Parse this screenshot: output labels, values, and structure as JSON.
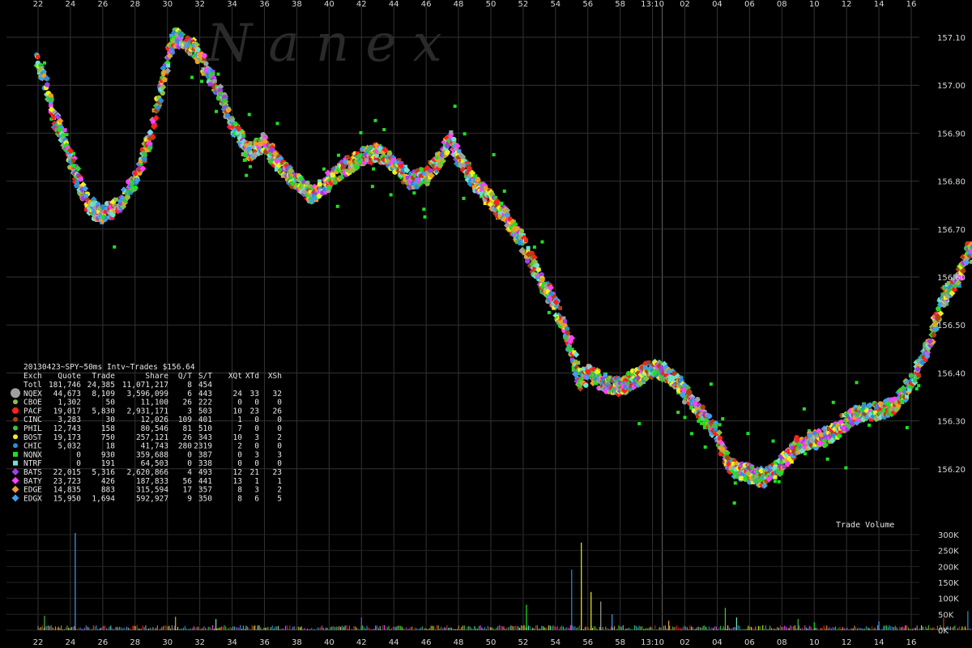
{
  "chart_data": {
    "type": "scatter",
    "title": "20130423~SPY~50ms Intv~Trades $156.64",
    "watermark": "N a n e x",
    "time_labels": [
      "22",
      "24",
      "26",
      "28",
      "30",
      "32",
      "34",
      "36",
      "38",
      "40",
      "42",
      "44",
      "46",
      "48",
      "50",
      "52",
      "54",
      "56",
      "58",
      "13:10",
      "02",
      "04",
      "06",
      "08",
      "10",
      "12",
      "14",
      "16"
    ],
    "price_ticks": [
      157.1,
      157.0,
      156.9,
      156.8,
      156.7,
      156.6,
      156.5,
      156.4,
      156.3,
      156.2
    ],
    "price_tick_labels": [
      "157.10",
      "157.00",
      "156.90",
      "156.80",
      "156.70",
      "156.60",
      "156.50",
      "156.40",
      "156.30",
      "156.20"
    ],
    "ylim": [
      156.17,
      157.12
    ],
    "volume_title": "Trade Volume",
    "volume_ticks": [
      "300K",
      "250K",
      "200K",
      "150K",
      "100K",
      "50K",
      "0K"
    ],
    "volume_ylim": [
      0,
      300000
    ],
    "price_path": [
      {
        "x": 0.0,
        "y": 157.05
      },
      {
        "x": 0.5,
        "y": 157.0
      },
      {
        "x": 1.0,
        "y": 156.93
      },
      {
        "x": 1.5,
        "y": 156.9
      },
      {
        "x": 2.0,
        "y": 156.85
      },
      {
        "x": 2.5,
        "y": 156.8
      },
      {
        "x": 3.0,
        "y": 156.76
      },
      {
        "x": 3.5,
        "y": 156.74
      },
      {
        "x": 4.0,
        "y": 156.73
      },
      {
        "x": 5.0,
        "y": 156.75
      },
      {
        "x": 6.0,
        "y": 156.8
      },
      {
        "x": 7.0,
        "y": 156.9
      },
      {
        "x": 7.5,
        "y": 156.98
      },
      {
        "x": 8.0,
        "y": 157.06
      },
      {
        "x": 8.5,
        "y": 157.1
      },
      {
        "x": 9.5,
        "y": 157.08
      },
      {
        "x": 10.0,
        "y": 157.06
      },
      {
        "x": 11.0,
        "y": 157.0
      },
      {
        "x": 12.0,
        "y": 156.92
      },
      {
        "x": 13.0,
        "y": 156.86
      },
      {
        "x": 14.0,
        "y": 156.88
      },
      {
        "x": 15.0,
        "y": 156.83
      },
      {
        "x": 16.0,
        "y": 156.8
      },
      {
        "x": 17.0,
        "y": 156.77
      },
      {
        "x": 18.0,
        "y": 156.8
      },
      {
        "x": 19.0,
        "y": 156.83
      },
      {
        "x": 20.0,
        "y": 156.85
      },
      {
        "x": 21.0,
        "y": 156.86
      },
      {
        "x": 22.0,
        "y": 156.84
      },
      {
        "x": 23.0,
        "y": 156.8
      },
      {
        "x": 24.0,
        "y": 156.81
      },
      {
        "x": 25.0,
        "y": 156.85
      },
      {
        "x": 25.5,
        "y": 156.89
      },
      {
        "x": 26.0,
        "y": 156.85
      },
      {
        "x": 27.0,
        "y": 156.8
      },
      {
        "x": 28.0,
        "y": 156.76
      },
      {
        "x": 29.0,
        "y": 156.72
      },
      {
        "x": 30.0,
        "y": 156.67
      },
      {
        "x": 31.0,
        "y": 156.6
      },
      {
        "x": 32.0,
        "y": 156.54
      },
      {
        "x": 33.0,
        "y": 156.45
      },
      {
        "x": 33.5,
        "y": 156.38
      },
      {
        "x": 34.0,
        "y": 156.4
      },
      {
        "x": 35.0,
        "y": 156.38
      },
      {
        "x": 36.0,
        "y": 156.37
      },
      {
        "x": 37.0,
        "y": 156.39
      },
      {
        "x": 38.0,
        "y": 156.41
      },
      {
        "x": 39.0,
        "y": 156.4
      },
      {
        "x": 40.0,
        "y": 156.36
      },
      {
        "x": 41.0,
        "y": 156.32
      },
      {
        "x": 42.0,
        "y": 156.27
      },
      {
        "x": 42.5,
        "y": 156.22
      },
      {
        "x": 43.0,
        "y": 156.2
      },
      {
        "x": 44.0,
        "y": 156.19
      },
      {
        "x": 45.0,
        "y": 156.18
      },
      {
        "x": 46.0,
        "y": 156.21
      },
      {
        "x": 47.0,
        "y": 156.25
      },
      {
        "x": 48.0,
        "y": 156.26
      },
      {
        "x": 49.0,
        "y": 156.27
      },
      {
        "x": 50.0,
        "y": 156.3
      },
      {
        "x": 51.0,
        "y": 156.32
      },
      {
        "x": 52.0,
        "y": 156.32
      },
      {
        "x": 53.0,
        "y": 156.33
      },
      {
        "x": 54.0,
        "y": 156.38
      },
      {
        "x": 55.0,
        "y": 156.45
      },
      {
        "x": 56.0,
        "y": 156.56
      },
      {
        "x": 57.0,
        "y": 156.6
      },
      {
        "x": 57.5,
        "y": 156.66
      },
      {
        "x": 58.0,
        "y": 156.63
      }
    ],
    "volume_spikes": [
      {
        "x": 2.3,
        "v": 305000
      },
      {
        "x": 0.4,
        "v": 45000
      },
      {
        "x": 8.5,
        "v": 42000
      },
      {
        "x": 11.0,
        "v": 35000
      },
      {
        "x": 20.0,
        "v": 40000
      },
      {
        "x": 30.2,
        "v": 80000
      },
      {
        "x": 33.0,
        "v": 190000
      },
      {
        "x": 33.6,
        "v": 275000
      },
      {
        "x": 34.2,
        "v": 120000
      },
      {
        "x": 34.8,
        "v": 90000
      },
      {
        "x": 35.5,
        "v": 50000
      },
      {
        "x": 39.0,
        "v": 30000
      },
      {
        "x": 42.5,
        "v": 70000
      },
      {
        "x": 43.2,
        "v": 40000
      },
      {
        "x": 47.0,
        "v": 35000
      },
      {
        "x": 48.0,
        "v": 25000
      },
      {
        "x": 52.0,
        "v": 28000
      },
      {
        "x": 56.0,
        "v": 38000
      },
      {
        "x": 57.5,
        "v": 60000
      }
    ],
    "legend": {
      "header": [
        "Exch",
        "Quote",
        "Trade",
        "Share",
        "Q/T",
        "S/T",
        "XQt",
        "XTd",
        "XSh"
      ],
      "rows": [
        {
          "exch": "Totl",
          "quote": "181,746",
          "trade": "24,385",
          "share": "11,071,217",
          "qt": "8",
          "st": "454",
          "xqt": "",
          "xtd": "",
          "xsh": "",
          "color": "",
          "marker": ""
        },
        {
          "exch": "NQEX",
          "quote": "44,673",
          "trade": "8,109",
          "share": "3,596,099",
          "qt": "6",
          "st": "443",
          "xqt": "24",
          "xtd": "33",
          "xsh": "32",
          "color": "#a0a0a0",
          "marker": "circle-large"
        },
        {
          "exch": "CBOE",
          "quote": "1,302",
          "trade": "50",
          "share": "11,100",
          "qt": "26",
          "st": "222",
          "xqt": "0",
          "xtd": "0",
          "xsh": "0",
          "color": "#8fbf3f",
          "marker": "circle"
        },
        {
          "exch": "PACF",
          "quote": "19,017",
          "trade": "5,830",
          "share": "2,931,171",
          "qt": "3",
          "st": "503",
          "xqt": "10",
          "xtd": "23",
          "xsh": "26",
          "color": "#ff2020",
          "marker": "circle-medium"
        },
        {
          "exch": "CINC",
          "quote": "3,283",
          "trade": "30",
          "share": "12,026",
          "qt": "109",
          "st": "401",
          "xqt": "1",
          "xtd": "0",
          "xsh": "0",
          "color": "#b04010",
          "marker": "circle"
        },
        {
          "exch": "PHIL",
          "quote": "12,743",
          "trade": "158",
          "share": "80,546",
          "qt": "81",
          "st": "510",
          "xqt": "7",
          "xtd": "0",
          "xsh": "0",
          "color": "#40c040",
          "marker": "circle"
        },
        {
          "exch": "BOST",
          "quote": "19,173",
          "trade": "750",
          "share": "257,121",
          "qt": "26",
          "st": "343",
          "xqt": "10",
          "xtd": "3",
          "xsh": "2",
          "color": "#f0f020",
          "marker": "circle"
        },
        {
          "exch": "CHIC",
          "quote": "5,032",
          "trade": "18",
          "share": "41,743",
          "qt": "280",
          "st": "2319",
          "xqt": "2",
          "xtd": "0",
          "xsh": "0",
          "color": "#2a8fd8",
          "marker": "circle"
        },
        {
          "exch": "NQNX",
          "quote": "0",
          "trade": "930",
          "share": "359,688",
          "qt": "0",
          "st": "387",
          "xqt": "0",
          "xtd": "3",
          "xsh": "3",
          "color": "#20e020",
          "marker": "square"
        },
        {
          "exch": "NTRF",
          "quote": "0",
          "trade": "191",
          "share": "64,503",
          "qt": "0",
          "st": "338",
          "xqt": "0",
          "xtd": "0",
          "xsh": "0",
          "color": "#70e0d0",
          "marker": "square"
        },
        {
          "exch": "BATS",
          "quote": "22,015",
          "trade": "5,316",
          "share": "2,620,866",
          "qt": "4",
          "st": "493",
          "xqt": "12",
          "xtd": "21",
          "xsh": "23",
          "color": "#a040e0",
          "marker": "diamond"
        },
        {
          "exch": "BATY",
          "quote": "23,723",
          "trade": "426",
          "share": "187,833",
          "qt": "56",
          "st": "441",
          "xqt": "13",
          "xtd": "1",
          "xsh": "1",
          "color": "#ff40ff",
          "marker": "diamond"
        },
        {
          "exch": "EDGE",
          "quote": "14,835",
          "trade": "883",
          "share": "315,594",
          "qt": "17",
          "st": "357",
          "xqt": "8",
          "xtd": "3",
          "xsh": "2",
          "color": "#f0a020",
          "marker": "diamond"
        },
        {
          "exch": "EDGX",
          "quote": "15,950",
          "trade": "1,694",
          "share": "592,927",
          "qt": "9",
          "st": "350",
          "xqt": "8",
          "xtd": "6",
          "xsh": "5",
          "color": "#40a0f0",
          "marker": "diamond"
        }
      ]
    },
    "grid": true,
    "background": "#000000",
    "grid_color": "#333333"
  }
}
